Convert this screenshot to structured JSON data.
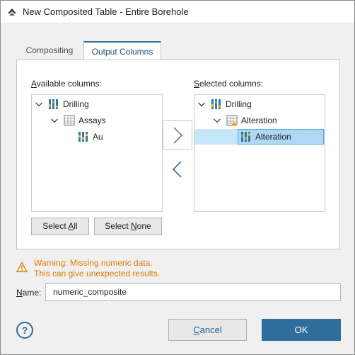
{
  "window": {
    "title": "New Composited Table - Entire Borehole"
  },
  "tabs": [
    {
      "label": "Compositing",
      "active": false
    },
    {
      "label": "Output Columns",
      "active": true
    }
  ],
  "available": {
    "label_prefix": "A",
    "label_rest": "vailable columns:",
    "tree": [
      {
        "label": "Drilling",
        "icon": "drillhole-icon",
        "expanded": true
      },
      {
        "label": "Assays",
        "icon": "table-icon",
        "expanded": true
      },
      {
        "label": "Au",
        "icon": "numeric-column-icon"
      }
    ],
    "select_all_prefix": "Select ",
    "select_all_accel": "A",
    "select_all_rest": "ll",
    "select_none_prefix": "Select ",
    "select_none_accel": "N",
    "select_none_rest": "one"
  },
  "selected": {
    "label_prefix": "S",
    "label_rest": "elected columns:",
    "tree": [
      {
        "label": "Drilling",
        "icon": "drillhole-icon",
        "expanded": true
      },
      {
        "label": "Alteration",
        "icon": "table-warning-icon",
        "expanded": true
      },
      {
        "label": "Alteration",
        "icon": "category-column-icon",
        "selected": true
      }
    ]
  },
  "transfer": {
    "add_icon": "chevron-right-icon",
    "remove_icon": "chevron-left-icon"
  },
  "warning": {
    "line1": "Warning: Missing numeric data.",
    "line2": "This can give unexpected results.",
    "color": "#e07b00"
  },
  "name_field": {
    "label_accel": "N",
    "label_rest": "ame:",
    "value": "numeric_composite"
  },
  "footer": {
    "help": "?",
    "cancel_accel": "C",
    "cancel_rest": "ancel",
    "ok": "OK",
    "accent": "#2f6e9a"
  }
}
